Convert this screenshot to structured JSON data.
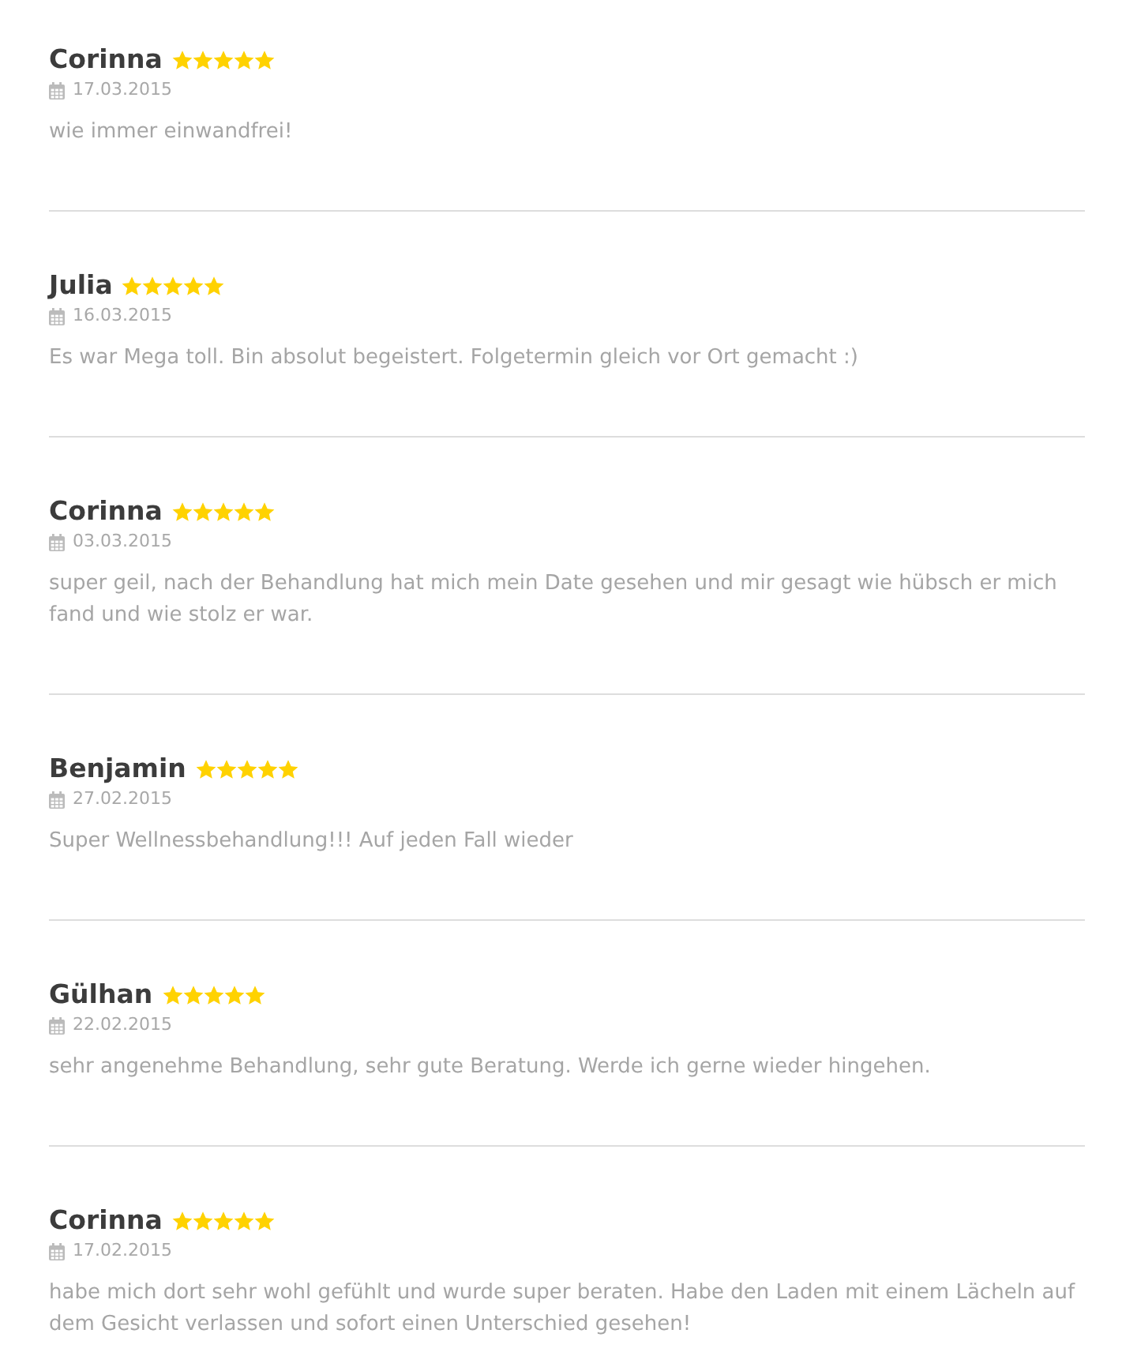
{
  "reviews": [
    {
      "name": "Corinna",
      "stars": 5,
      "date": "17.03.2015",
      "text": "wie immer einwandfrei!"
    },
    {
      "name": "Julia",
      "stars": 5,
      "date": "16.03.2015",
      "text": "Es war Mega toll. Bin absolut begeistert. Folgetermin gleich vor Ort gemacht :)"
    },
    {
      "name": "Corinna",
      "stars": 5,
      "date": "03.03.2015",
      "text": "super geil, nach der Behandlung hat mich mein Date gesehen und mir gesagt wie hübsch er mich fand und wie stolz er war."
    },
    {
      "name": "Benjamin",
      "stars": 5,
      "date": "27.02.2015",
      "text": "Super Wellnessbehandlung!!! Auf jeden Fall wieder"
    },
    {
      "name": "Gülhan",
      "stars": 5,
      "date": "22.02.2015",
      "text": "sehr angenehme Behandlung, sehr gute Beratung. Werde ich gerne wieder hingehen."
    },
    {
      "name": "Corinna",
      "stars": 5,
      "date": "17.02.2015",
      "text": "habe mich dort sehr wohl gefühlt und wurde super beraten. Habe den Laden mit einem Lächeln auf dem Gesicht verlassen und sofort einen Unterschied gesehen!"
    }
  ]
}
